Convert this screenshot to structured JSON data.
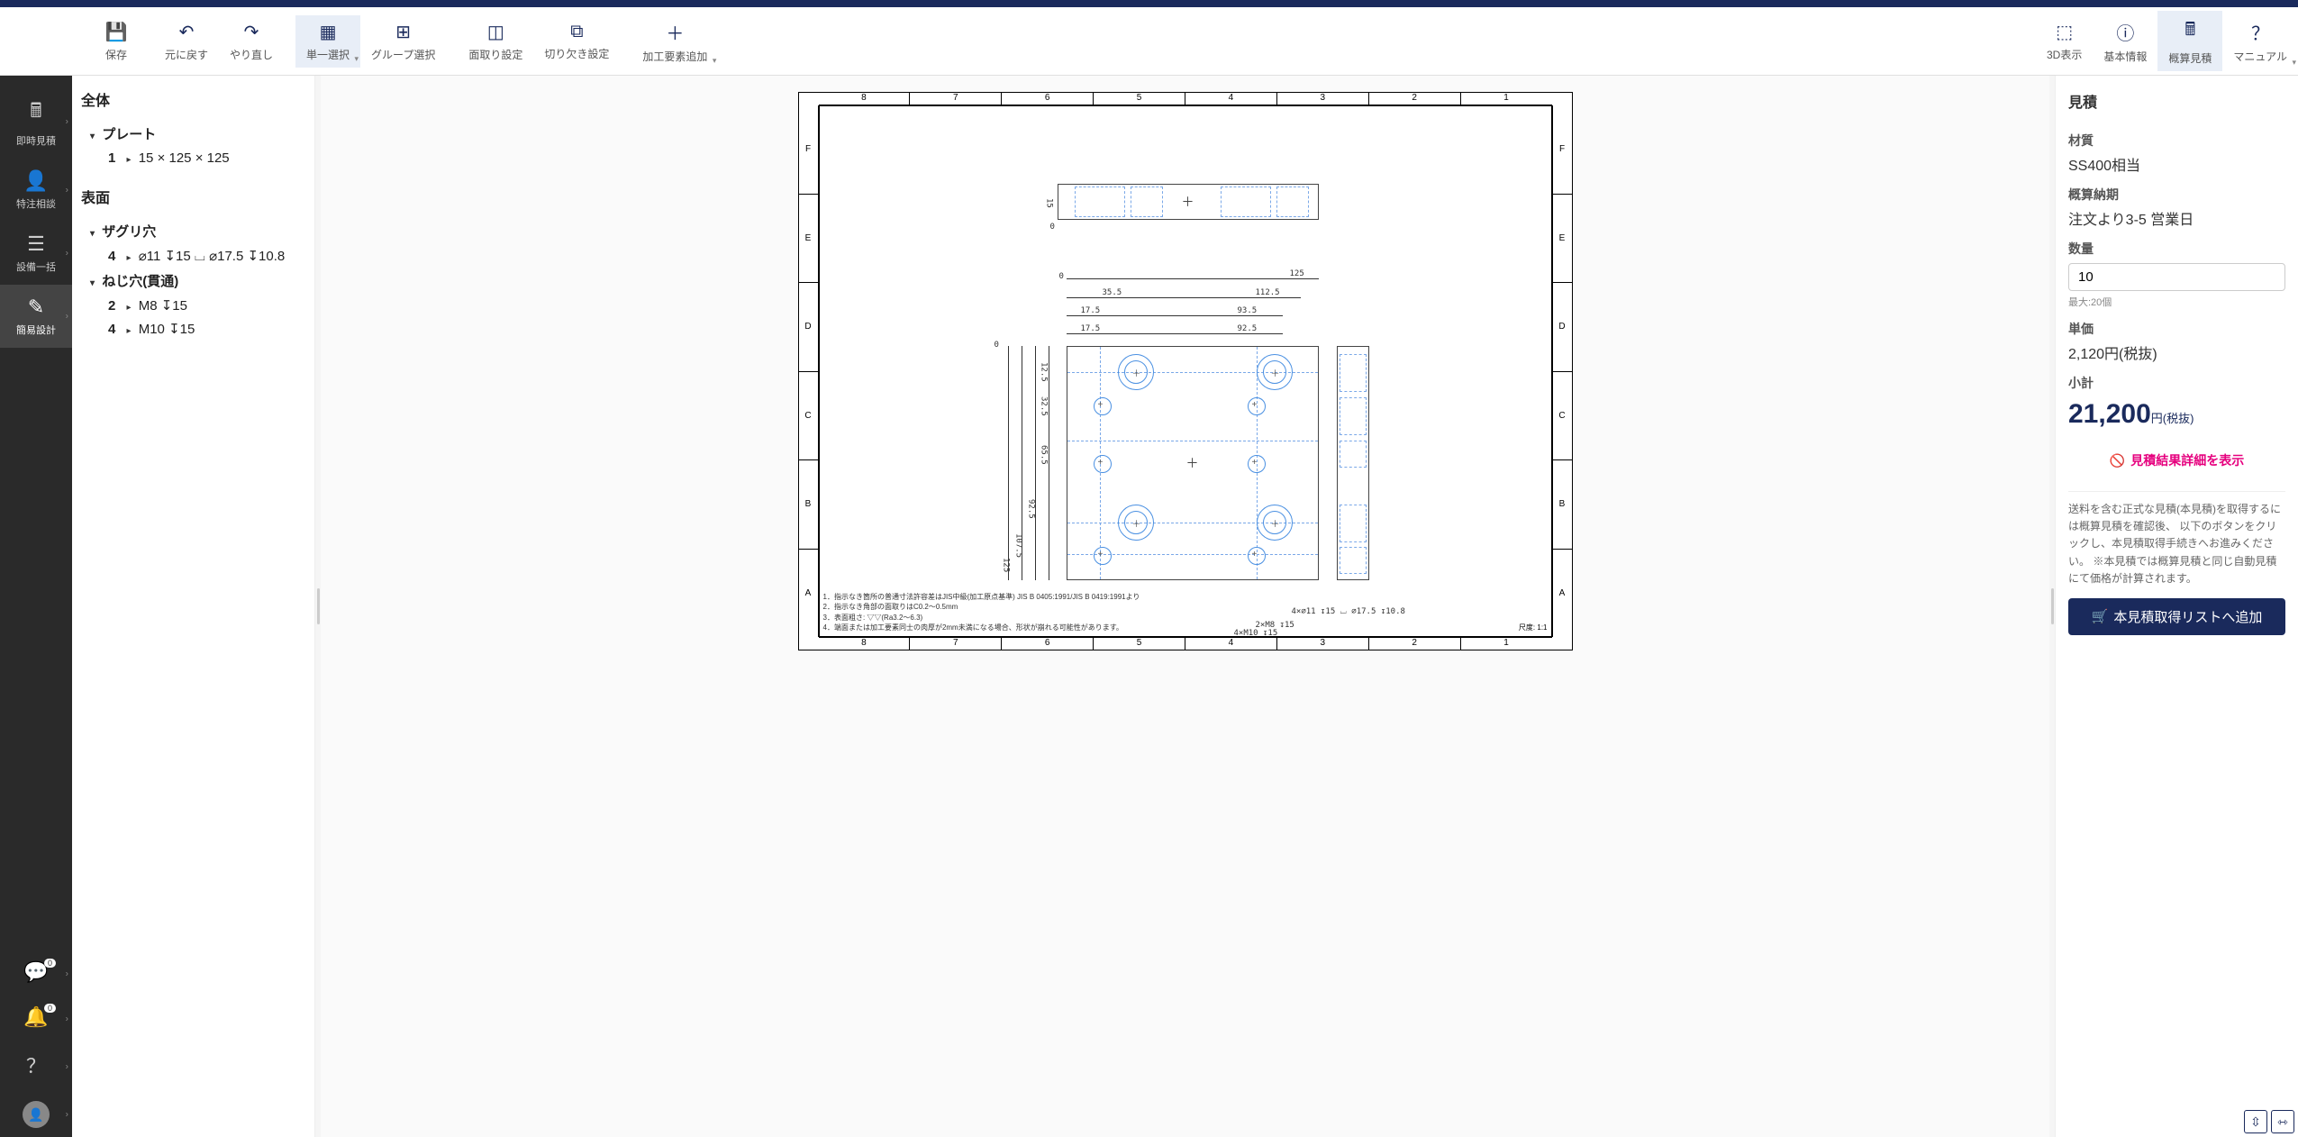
{
  "toolbar": {
    "save": "保存",
    "undo": "元に戻す",
    "redo": "やり直し",
    "single_select": "単一選択",
    "group_select": "グループ選択",
    "chamfer": "面取り設定",
    "notch": "切り欠き設定",
    "add_feature": "加工要素追加",
    "view3d": "3D表示",
    "basic_info": "基本情報",
    "rough_quote": "概算見積",
    "manual": "マニュアル"
  },
  "left_nav": {
    "instant_quote": "即時見積",
    "custom_inquiry": "特注相談",
    "equipment": "設備一括",
    "easy_design": "簡易設計",
    "badge_count": "0"
  },
  "tree": {
    "overall_title": "全体",
    "plate_label": "プレート",
    "plate_item_idx": "1",
    "plate_item_text": "15 × 125 × 125",
    "surface_title": "表面",
    "counterbore_label": "ザグリ穴",
    "counterbore_idx": "4",
    "counterbore_text": "⌀11 ↧15 ⌴ ⌀17.5 ↧10.8",
    "thread_label": "ねじ穴(貫通)",
    "thread1_idx": "2",
    "thread1_text": "M8 ↧15",
    "thread2_idx": "4",
    "thread2_text": "M10 ↧15"
  },
  "drawing": {
    "cols": [
      "8",
      "7",
      "6",
      "5",
      "4",
      "3",
      "2",
      "1"
    ],
    "rows": [
      "F",
      "E",
      "D",
      "C",
      "B",
      "A"
    ],
    "origin0_a": "0",
    "origin0_b": "0",
    "origin0_c": "0",
    "dim_15": "15",
    "dim_125": "125",
    "d_35_5": "35.5",
    "d_112_5": "112.5",
    "d_17_5a": "17.5",
    "d_93_5": "93.5",
    "d_17_5b": "17.5",
    "d_92_5": "92.5",
    "d_12_5": "12.5",
    "d_32_5": "32.5",
    "d_65_5": "65.5",
    "d_92_5v": "92.5",
    "d_107_5": "107.5",
    "d_125v": "125",
    "callout_cb": "4×⌀11 ↧15 ⌴ ⌀17.5 ↧10.8",
    "callout_m8": "2×M8 ↧15",
    "callout_m10": "4×M10 ↧15",
    "note1": "1．指示なき箇所の普通寸法許容差はJIS中級(加工原点基準) JIS B 0405:1991/JIS B 0419:1991より",
    "note2": "2．指示なき角部の面取りはC0.2～0.5mm",
    "note3": "3．表面粗さ: ▽▽(Ra3.2～6.3)",
    "note4": "4．端面または加工要素同士の肉厚が2mm未満になる場合、形状が崩れる可能性があります。",
    "scale": "尺度: 1:1"
  },
  "quote": {
    "title": "見積",
    "material_label": "材質",
    "material_value": "SS400相当",
    "leadtime_label": "概算納期",
    "leadtime_value": "注文より3-5 営業日",
    "qty_label": "数量",
    "qty_value": "10",
    "qty_max": "最大:20個",
    "unit_label": "単価",
    "unit_value": "2,120円(税抜)",
    "subtotal_label": "小計",
    "subtotal_value": "21,200",
    "subtotal_suffix": "円(税抜)",
    "detail_link": "見積結果詳細を表示",
    "note_text": "送料を含む正式な見積(本見積)を取得するには概算見積を確認後、\n以下のボタンをクリックし、本見積取得手続きへお進みください。\n※本見積では概算見積と同じ自動見積にて価格が計算されます。",
    "button": "本見積取得リストへ追加"
  }
}
